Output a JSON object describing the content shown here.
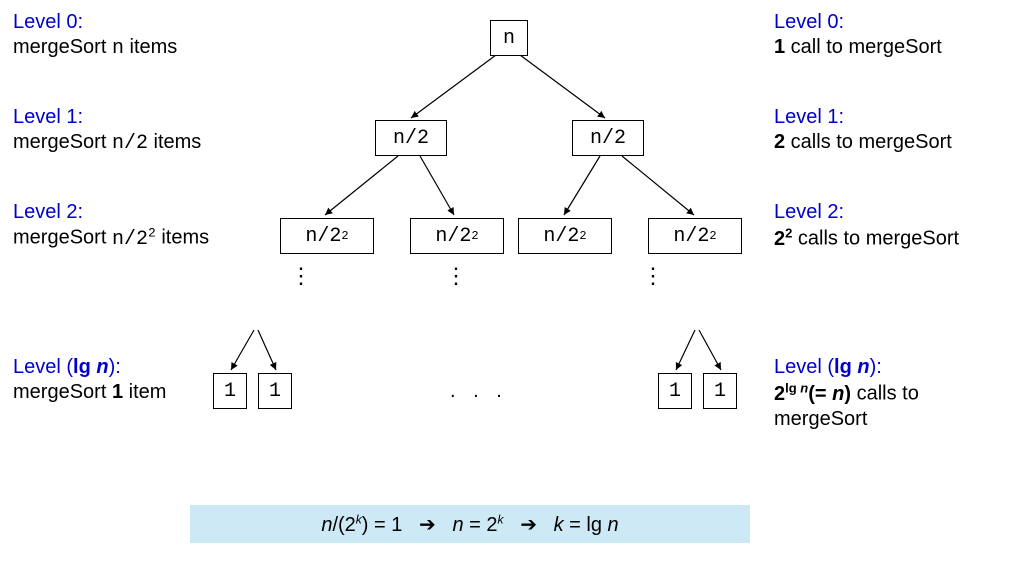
{
  "left": {
    "l0_title": "Level 0:",
    "l0_text_a": "mergeSort ",
    "l0_text_b": " items",
    "l0_code": "n",
    "l1_title": "Level 1:",
    "l1_text_a": "mergeSort ",
    "l1_text_b": " items",
    "l1_code": "n/2",
    "l2_title": "Level 2:",
    "l2_text_a": "mergeSort ",
    "l2_text_b": " items",
    "l2_code_base": "n/2",
    "l2_code_sup": "2",
    "l3_title_a": "Level (",
    "l3_title_b": "lg ",
    "l3_title_c": "n",
    "l3_title_d": "):",
    "l3_text_a": "mergeSort ",
    "l3_text_b": "1",
    "l3_text_c": " item"
  },
  "right": {
    "l0_title": "Level 0:",
    "l0_text_a": "1",
    "l0_text_b": " call to mergeSort",
    "l1_title": "Level 1:",
    "l1_text_a": "2",
    "l1_text_b": " calls to mergeSort",
    "l2_title": "Level 2:",
    "l2_text_a": "2",
    "l2_text_sup": "2",
    "l2_text_b": " calls to mergeSort",
    "l3_title_a": "Level (",
    "l3_title_b": "lg ",
    "l3_title_c": "n",
    "l3_title_d": "):",
    "l3_text_a": "2",
    "l3_text_b": "lg ",
    "l3_text_c": "n",
    "l3_text_d": "(= ",
    "l3_text_e": "n",
    "l3_text_f": ")",
    "l3_text_g": " calls to",
    "l3_text_h": "mergeSort"
  },
  "tree": {
    "n": "n",
    "n2": "n/2",
    "n4_base": "n/2",
    "n4_sup": "2",
    "one": "1",
    "vdots": "⋮",
    "hdots": ". . ."
  },
  "footer": {
    "a_n": "n",
    "a_open": "/(2",
    "a_k": "k",
    "a_close": ") = 1",
    "arrow": "➔",
    "b_n": "n",
    "b_eq": " = 2",
    "b_k": "k",
    "c_k": "k",
    "c_eq": " = lg ",
    "c_n": "n"
  }
}
